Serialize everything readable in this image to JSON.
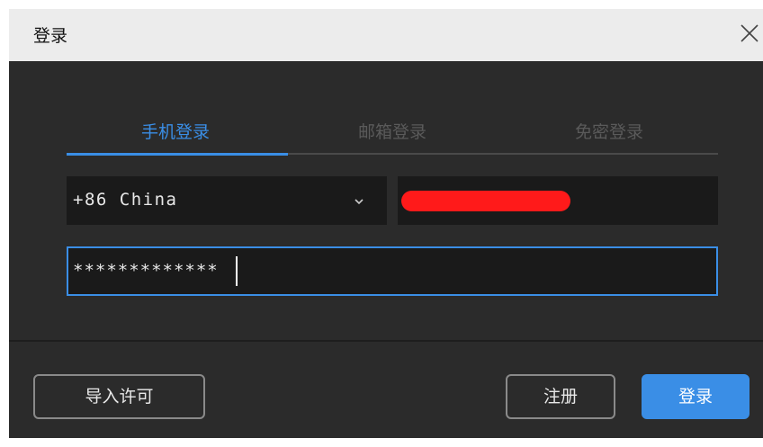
{
  "window": {
    "title": "登录"
  },
  "tabs": [
    {
      "label": "手机登录",
      "active": true
    },
    {
      "label": "邮箱登录",
      "active": false
    },
    {
      "label": "免密登录",
      "active": false
    }
  ],
  "form": {
    "country_code": "+86  China",
    "phone_value": "[redacted]",
    "password_value": "*************"
  },
  "footer": {
    "import_license_label": "导入许可",
    "register_label": "注册",
    "login_label": "登录"
  },
  "colors": {
    "accent": "#3a8ee6",
    "background": "#2b2b2b",
    "field": "#1a1a1a",
    "redaction": "#ff1a1a"
  }
}
